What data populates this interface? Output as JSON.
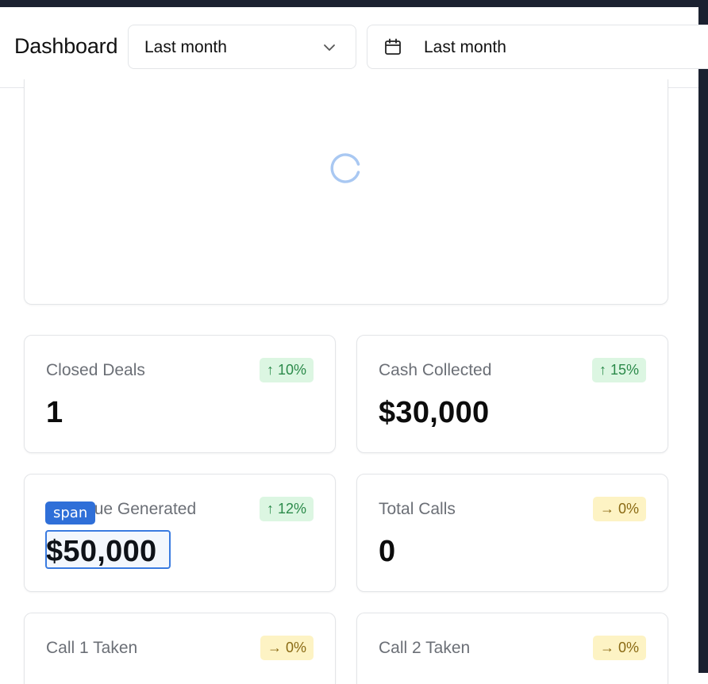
{
  "header": {
    "title": "Dashboard",
    "period_select": {
      "value": "Last month",
      "icon": "chevron-down-icon"
    },
    "date_picker": {
      "value": "Last month",
      "icon": "calendar-icon"
    }
  },
  "loader": {
    "icon": "loading-spinner-icon"
  },
  "cards": [
    {
      "label": "Closed Deals",
      "value": "1",
      "badge": "↑ 10%",
      "trend": "up"
    },
    {
      "label": "Cash Collected",
      "value": "$30,000",
      "badge": "↑ 15%",
      "trend": "up"
    },
    {
      "label": "Revenue Generated",
      "value": "$50,000",
      "badge": "↑ 12%",
      "trend": "up"
    },
    {
      "label": "Total Calls",
      "value": "0",
      "badge": "→ 0%",
      "trend": "flat"
    },
    {
      "label": "Call 1 Taken",
      "value": "",
      "badge": "→ 0%",
      "trend": "flat"
    },
    {
      "label": "Call 2 Taken",
      "value": "",
      "badge": "→ 0%",
      "trend": "flat"
    }
  ],
  "inspector": {
    "tag": "span"
  },
  "colors": {
    "up_bg": "#dcf6e2",
    "up_fg": "#2b8a4a",
    "flat_bg": "#fdf3c4",
    "flat_fg": "#8a6a14",
    "inspector": "#2f6fd8"
  }
}
